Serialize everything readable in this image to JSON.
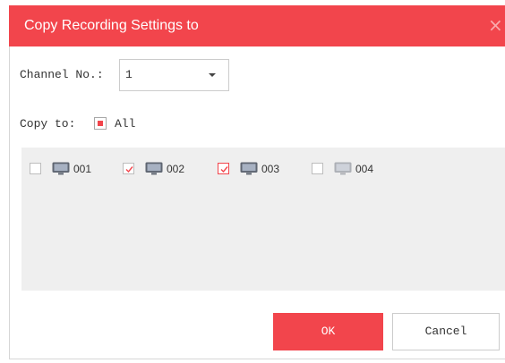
{
  "header": {
    "title": "Copy Recording Settings to",
    "close_glyph": "×",
    "close_icon": "close-icon"
  },
  "channel": {
    "label": "Channel No.:",
    "value": "1",
    "arrow_icon": "dropdown-arrow-icon"
  },
  "copy_to": {
    "label": "Copy to:",
    "all_label": "All",
    "all_indeterminate": true
  },
  "channels": [
    {
      "label": "001",
      "checked": false,
      "focused": false,
      "online": true,
      "icon": "monitor-icon"
    },
    {
      "label": "002",
      "checked": true,
      "focused": false,
      "online": true,
      "icon": "monitor-icon"
    },
    {
      "label": "003",
      "checked": true,
      "focused": true,
      "online": true,
      "icon": "monitor-icon"
    },
    {
      "label": "004",
      "checked": false,
      "focused": false,
      "online": false,
      "icon": "monitor-icon"
    }
  ],
  "buttons": {
    "ok": "OK",
    "cancel": "Cancel"
  },
  "colors": {
    "accent": "#f2454c",
    "panel": "#efefef"
  }
}
